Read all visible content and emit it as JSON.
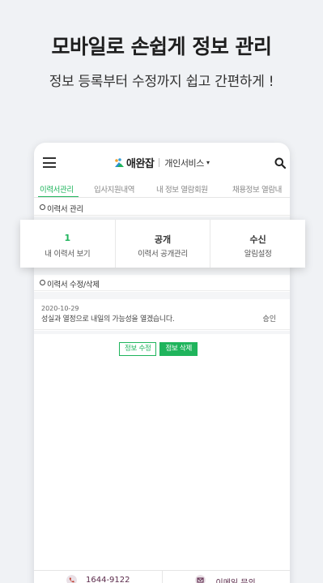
{
  "promo": {
    "title": "모바일로 손쉽게 정보 관리",
    "subtitle": "정보 등록부터 수정까지 쉽고 간편하게 !"
  },
  "appbar": {
    "brand_name": "애완잡",
    "service_label": "개인서비스",
    "service_caret": "▾"
  },
  "tabs": [
    {
      "label": "이력서관리",
      "active": true
    },
    {
      "label": "입사지원내역",
      "active": false
    },
    {
      "label": "내 정보 열람회원",
      "active": false
    },
    {
      "label": "채용정보 열람내",
      "active": false
    }
  ],
  "sections": {
    "resume_manage": "이력서 관리",
    "resume_edit": "이력서 수정/삭제"
  },
  "stats": [
    {
      "top": "1",
      "bottom": "내 이력서 보기"
    },
    {
      "top": "공개",
      "bottom": "이력서 공개관리"
    },
    {
      "top": "수신",
      "bottom": "알림설정"
    }
  ],
  "record": {
    "date": "2020-10-29",
    "title": "성실과 열정으로 내일의 가능성을 열겠습니다.",
    "status": "승인"
  },
  "buttons": {
    "edit": "정보 수정",
    "delete": "정보 삭제"
  },
  "footer": {
    "phone": "1644-9122",
    "email": "이메일 문의"
  },
  "colors": {
    "accent": "#1fb45c",
    "background": "#f0f2f5"
  }
}
